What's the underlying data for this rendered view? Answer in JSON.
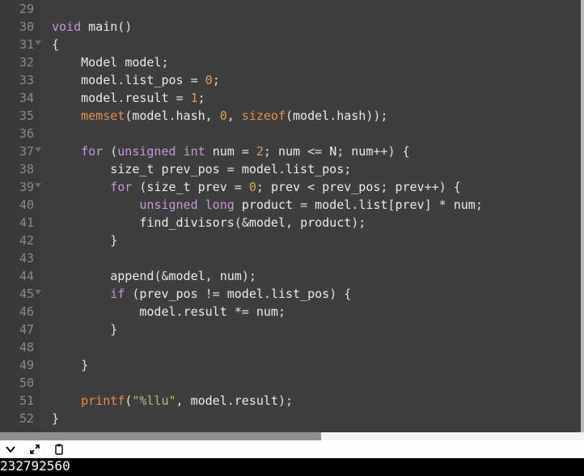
{
  "editor": {
    "first_line_number": 29,
    "fold_lines": [
      31,
      37,
      39,
      45
    ],
    "lines": [
      [],
      [
        {
          "c": "kw",
          "t": "void"
        },
        {
          "c": "plain",
          "t": " "
        },
        {
          "c": "ident",
          "t": "main"
        },
        {
          "c": "punc",
          "t": "()"
        }
      ],
      [
        {
          "c": "punc",
          "t": "{"
        }
      ],
      [
        {
          "c": "plain",
          "t": "    "
        },
        {
          "c": "type",
          "t": "Model"
        },
        {
          "c": "plain",
          "t": " "
        },
        {
          "c": "ident",
          "t": "model"
        },
        {
          "c": "punc",
          "t": ";"
        }
      ],
      [
        {
          "c": "plain",
          "t": "    "
        },
        {
          "c": "ident",
          "t": "model"
        },
        {
          "c": "punc",
          "t": "."
        },
        {
          "c": "ident",
          "t": "list_pos"
        },
        {
          "c": "plain",
          "t": " "
        },
        {
          "c": "op",
          "t": "="
        },
        {
          "c": "plain",
          "t": " "
        },
        {
          "c": "num",
          "t": "0"
        },
        {
          "c": "punc",
          "t": ";"
        }
      ],
      [
        {
          "c": "plain",
          "t": "    "
        },
        {
          "c": "ident",
          "t": "model"
        },
        {
          "c": "punc",
          "t": "."
        },
        {
          "c": "ident",
          "t": "result"
        },
        {
          "c": "plain",
          "t": " "
        },
        {
          "c": "op",
          "t": "="
        },
        {
          "c": "plain",
          "t": " "
        },
        {
          "c": "num",
          "t": "1"
        },
        {
          "c": "punc",
          "t": ";"
        }
      ],
      [
        {
          "c": "plain",
          "t": "    "
        },
        {
          "c": "fn",
          "t": "memset"
        },
        {
          "c": "punc",
          "t": "("
        },
        {
          "c": "ident",
          "t": "model"
        },
        {
          "c": "punc",
          "t": "."
        },
        {
          "c": "ident",
          "t": "hash"
        },
        {
          "c": "punc",
          "t": ", "
        },
        {
          "c": "num",
          "t": "0"
        },
        {
          "c": "punc",
          "t": ", "
        },
        {
          "c": "fn",
          "t": "sizeof"
        },
        {
          "c": "punc",
          "t": "("
        },
        {
          "c": "ident",
          "t": "model"
        },
        {
          "c": "punc",
          "t": "."
        },
        {
          "c": "ident",
          "t": "hash"
        },
        {
          "c": "punc",
          "t": "));"
        }
      ],
      [],
      [
        {
          "c": "plain",
          "t": "    "
        },
        {
          "c": "kw",
          "t": "for"
        },
        {
          "c": "plain",
          "t": " "
        },
        {
          "c": "punc",
          "t": "("
        },
        {
          "c": "kw",
          "t": "unsigned"
        },
        {
          "c": "plain",
          "t": " "
        },
        {
          "c": "kw",
          "t": "int"
        },
        {
          "c": "plain",
          "t": " "
        },
        {
          "c": "ident",
          "t": "num"
        },
        {
          "c": "plain",
          "t": " "
        },
        {
          "c": "op",
          "t": "="
        },
        {
          "c": "plain",
          "t": " "
        },
        {
          "c": "num",
          "t": "2"
        },
        {
          "c": "punc",
          "t": "; "
        },
        {
          "c": "ident",
          "t": "num"
        },
        {
          "c": "plain",
          "t": " "
        },
        {
          "c": "op",
          "t": "<="
        },
        {
          "c": "plain",
          "t": " "
        },
        {
          "c": "ident",
          "t": "N"
        },
        {
          "c": "punc",
          "t": "; "
        },
        {
          "c": "ident",
          "t": "num"
        },
        {
          "c": "op",
          "t": "++"
        },
        {
          "c": "punc",
          "t": ") {"
        }
      ],
      [
        {
          "c": "plain",
          "t": "        "
        },
        {
          "c": "type",
          "t": "size_t"
        },
        {
          "c": "plain",
          "t": " "
        },
        {
          "c": "ident",
          "t": "prev_pos"
        },
        {
          "c": "plain",
          "t": " "
        },
        {
          "c": "op",
          "t": "="
        },
        {
          "c": "plain",
          "t": " "
        },
        {
          "c": "ident",
          "t": "model"
        },
        {
          "c": "punc",
          "t": "."
        },
        {
          "c": "ident",
          "t": "list_pos"
        },
        {
          "c": "punc",
          "t": ";"
        }
      ],
      [
        {
          "c": "plain",
          "t": "        "
        },
        {
          "c": "kw",
          "t": "for"
        },
        {
          "c": "plain",
          "t": " "
        },
        {
          "c": "punc",
          "t": "("
        },
        {
          "c": "type",
          "t": "size_t"
        },
        {
          "c": "plain",
          "t": " "
        },
        {
          "c": "ident",
          "t": "prev"
        },
        {
          "c": "plain",
          "t": " "
        },
        {
          "c": "op",
          "t": "="
        },
        {
          "c": "plain",
          "t": " "
        },
        {
          "c": "num",
          "t": "0"
        },
        {
          "c": "punc",
          "t": "; "
        },
        {
          "c": "ident",
          "t": "prev"
        },
        {
          "c": "plain",
          "t": " "
        },
        {
          "c": "op",
          "t": "<"
        },
        {
          "c": "plain",
          "t": " "
        },
        {
          "c": "ident",
          "t": "prev_pos"
        },
        {
          "c": "punc",
          "t": "; "
        },
        {
          "c": "ident",
          "t": "prev"
        },
        {
          "c": "op",
          "t": "++"
        },
        {
          "c": "punc",
          "t": ") {"
        }
      ],
      [
        {
          "c": "plain",
          "t": "            "
        },
        {
          "c": "kw",
          "t": "unsigned"
        },
        {
          "c": "plain",
          "t": " "
        },
        {
          "c": "kw",
          "t": "long"
        },
        {
          "c": "plain",
          "t": " "
        },
        {
          "c": "ident",
          "t": "product"
        },
        {
          "c": "plain",
          "t": " "
        },
        {
          "c": "op",
          "t": "="
        },
        {
          "c": "plain",
          "t": " "
        },
        {
          "c": "ident",
          "t": "model"
        },
        {
          "c": "punc",
          "t": "."
        },
        {
          "c": "ident",
          "t": "list"
        },
        {
          "c": "punc",
          "t": "["
        },
        {
          "c": "ident",
          "t": "prev"
        },
        {
          "c": "punc",
          "t": "] "
        },
        {
          "c": "op",
          "t": "*"
        },
        {
          "c": "plain",
          "t": " "
        },
        {
          "c": "ident",
          "t": "num"
        },
        {
          "c": "punc",
          "t": ";"
        }
      ],
      [
        {
          "c": "plain",
          "t": "            "
        },
        {
          "c": "ident",
          "t": "find_divisors"
        },
        {
          "c": "punc",
          "t": "("
        },
        {
          "c": "op",
          "t": "&"
        },
        {
          "c": "ident",
          "t": "model"
        },
        {
          "c": "punc",
          "t": ", "
        },
        {
          "c": "ident",
          "t": "product"
        },
        {
          "c": "punc",
          "t": ");"
        }
      ],
      [
        {
          "c": "plain",
          "t": "        "
        },
        {
          "c": "punc",
          "t": "}"
        }
      ],
      [],
      [
        {
          "c": "plain",
          "t": "        "
        },
        {
          "c": "ident",
          "t": "append"
        },
        {
          "c": "punc",
          "t": "("
        },
        {
          "c": "op",
          "t": "&"
        },
        {
          "c": "ident",
          "t": "model"
        },
        {
          "c": "punc",
          "t": ", "
        },
        {
          "c": "ident",
          "t": "num"
        },
        {
          "c": "punc",
          "t": ");"
        }
      ],
      [
        {
          "c": "plain",
          "t": "        "
        },
        {
          "c": "kw",
          "t": "if"
        },
        {
          "c": "plain",
          "t": " "
        },
        {
          "c": "punc",
          "t": "("
        },
        {
          "c": "ident",
          "t": "prev_pos"
        },
        {
          "c": "plain",
          "t": " "
        },
        {
          "c": "op",
          "t": "!="
        },
        {
          "c": "plain",
          "t": " "
        },
        {
          "c": "ident",
          "t": "model"
        },
        {
          "c": "punc",
          "t": "."
        },
        {
          "c": "ident",
          "t": "list_pos"
        },
        {
          "c": "punc",
          "t": ") {"
        }
      ],
      [
        {
          "c": "plain",
          "t": "            "
        },
        {
          "c": "ident",
          "t": "model"
        },
        {
          "c": "punc",
          "t": "."
        },
        {
          "c": "ident",
          "t": "result"
        },
        {
          "c": "plain",
          "t": " "
        },
        {
          "c": "op",
          "t": "*="
        },
        {
          "c": "plain",
          "t": " "
        },
        {
          "c": "ident",
          "t": "num"
        },
        {
          "c": "punc",
          "t": ";"
        }
      ],
      [
        {
          "c": "plain",
          "t": "        "
        },
        {
          "c": "punc",
          "t": "}"
        }
      ],
      [],
      [
        {
          "c": "plain",
          "t": "    "
        },
        {
          "c": "punc",
          "t": "}"
        }
      ],
      [],
      [
        {
          "c": "plain",
          "t": "    "
        },
        {
          "c": "fn",
          "t": "printf"
        },
        {
          "c": "punc",
          "t": "("
        },
        {
          "c": "str",
          "t": "\"%llu\""
        },
        {
          "c": "punc",
          "t": ", "
        },
        {
          "c": "ident",
          "t": "model"
        },
        {
          "c": "punc",
          "t": "."
        },
        {
          "c": "ident",
          "t": "result"
        },
        {
          "c": "punc",
          "t": ");"
        }
      ],
      [
        {
          "c": "punc",
          "t": "}"
        }
      ]
    ]
  },
  "console": {
    "output": "232792560"
  }
}
